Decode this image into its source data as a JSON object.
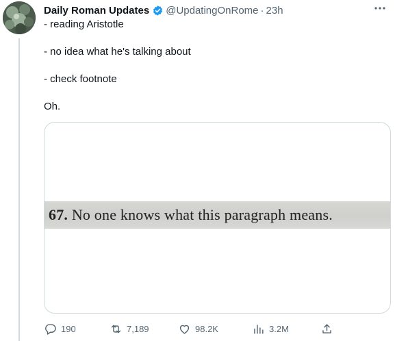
{
  "tweet": {
    "author_name": "Daily Roman Updates",
    "handle": "@UpdatingOnRome",
    "separator": "·",
    "time": "23h",
    "lines": [
      "- reading Aristotle",
      "- no idea what he's talking about",
      "- check footnote",
      "Oh."
    ],
    "media": {
      "number": "67.",
      "sentence": "No one knows what this paragraph means."
    }
  },
  "actions": {
    "replies": "190",
    "retweets": "7,189",
    "likes": "98.2K",
    "views": "3.2M"
  },
  "icons": {
    "verified": "verified-badge-icon",
    "more": "more-icon",
    "reply": "reply-icon",
    "retweet": "retweet-icon",
    "like": "heart-icon",
    "views": "views-icon",
    "share": "share-icon"
  },
  "colors": {
    "verified": "#1d9bf0",
    "text": "#0f1419",
    "secondary": "#536471",
    "border": "#cfd9de"
  }
}
